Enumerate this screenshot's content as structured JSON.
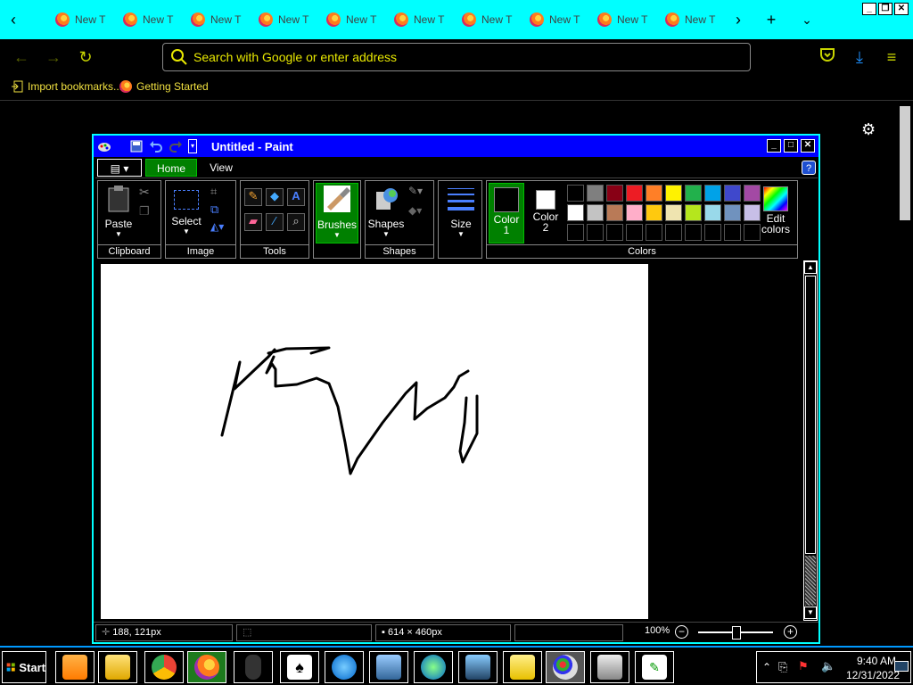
{
  "browser": {
    "tabs": [
      {
        "label": "New T"
      },
      {
        "label": "New T"
      },
      {
        "label": "New T"
      },
      {
        "label": "New T"
      },
      {
        "label": "New T"
      },
      {
        "label": "New T"
      },
      {
        "label": "New T"
      },
      {
        "label": "New T"
      },
      {
        "label": "New T"
      },
      {
        "label": "New T"
      }
    ],
    "new_tab_symbol": "+",
    "url_placeholder": "Search with Google or enter address",
    "bookmarks": [
      {
        "label": "Import bookmarks..."
      },
      {
        "label": "Getting Started"
      }
    ]
  },
  "paint": {
    "title": "Untitled - Paint",
    "ribbon_tabs": [
      "Home",
      "View"
    ],
    "groups": {
      "clipboard": {
        "label": "Clipboard",
        "paste": "Paste"
      },
      "image": {
        "label": "Image",
        "select": "Select"
      },
      "tools": {
        "label": "Tools"
      },
      "brushes": {
        "label": "Brushes"
      },
      "shapes": {
        "label": "Shapes",
        "shapes_btn": "Shapes"
      },
      "size": {
        "label": "Size"
      },
      "colors": {
        "label": "Colors",
        "color1": "Color",
        "color1_num": "1",
        "color2": "Color",
        "color2_num": "2",
        "edit": "Edit",
        "edit2": "colors",
        "palette_row1": [
          "#000000",
          "#7f7f7f",
          "#880015",
          "#ed1c24",
          "#ff7f27",
          "#fff200",
          "#22b14c",
          "#00a2e8",
          "#3f48cc",
          "#a349a4"
        ],
        "palette_row2": [
          "#ffffff",
          "#c3c3c3",
          "#b97a57",
          "#ffaec9",
          "#ffc90e",
          "#efe4b0",
          "#b5e61d",
          "#99d9ea",
          "#7092be",
          "#c8bfe7"
        ]
      }
    },
    "status": {
      "cursor_pos": "188, 121px",
      "canvas_size": "614 × 460px",
      "zoom": "100%"
    }
  },
  "taskbar": {
    "start_label": "Start",
    "time": "9:40 AM",
    "date": "12/31/2022"
  }
}
